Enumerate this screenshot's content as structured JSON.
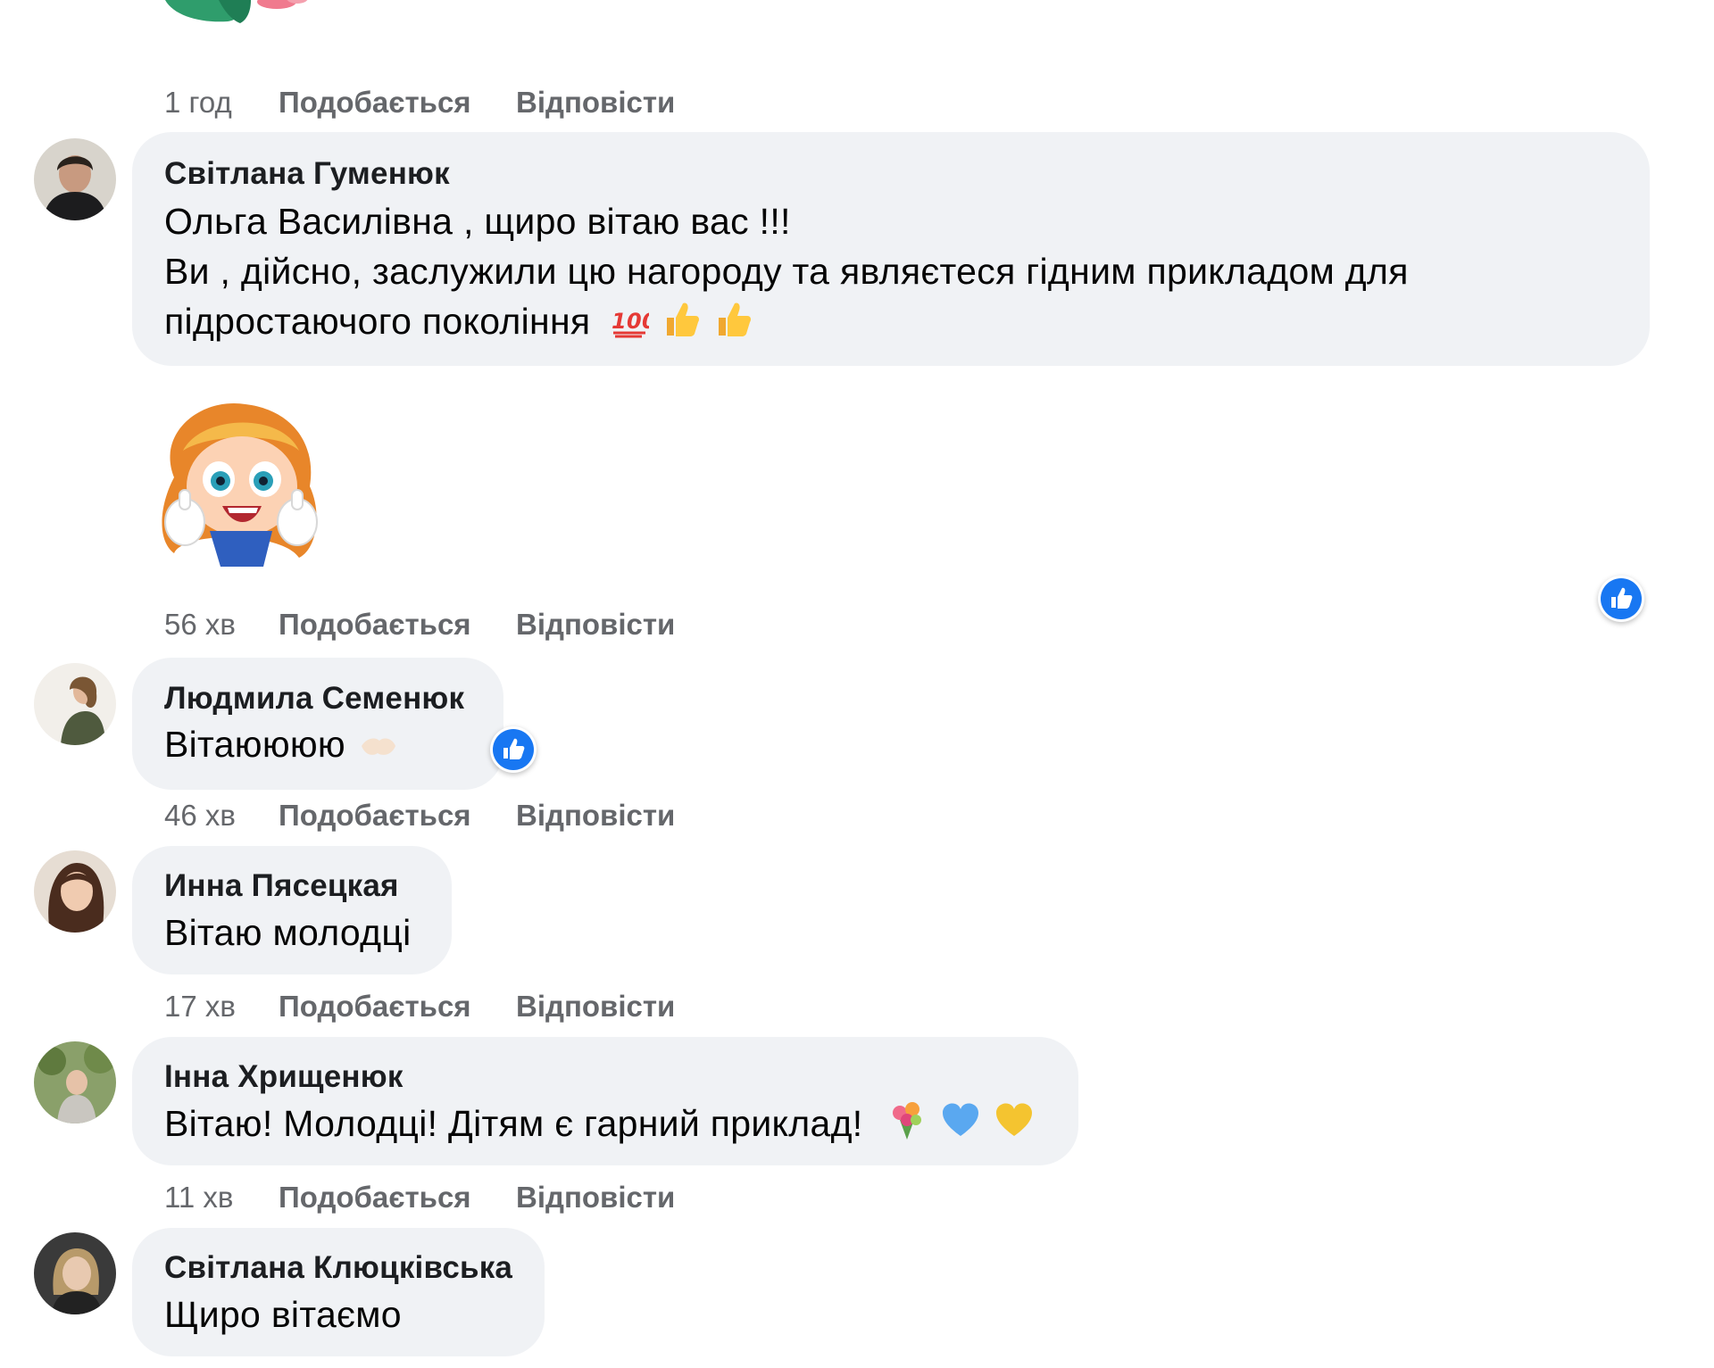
{
  "comments": [
    {
      "time": "1 год",
      "like_label": "Подобається",
      "reply_label": "Відповісти"
    },
    {
      "author": "Світлана Гуменюк",
      "text_lines": [
        "Ольга Василівна , щиро вітаю вас !!!",
        "Ви , дійсно, заслужили цю нагороду та являєтеся гідним прикладом для",
        "підростаючого покоління"
      ],
      "emoji": [
        "hundred-points-icon",
        "thumbs-up-icon",
        "thumbs-up-icon"
      ],
      "sticker": "girl-thumbs-up-sticker",
      "time": "56 хв",
      "like_label": "Подобається",
      "reply_label": "Відповісти",
      "reaction": "like"
    },
    {
      "author": "Людмила Семенюк",
      "text": "Вітаюююю",
      "emoji": [
        "handshake-icon"
      ],
      "time": "46 хв",
      "like_label": "Подобається",
      "reply_label": "Відповісти",
      "reaction": "like"
    },
    {
      "author": "Инна Пясецкая",
      "text": "Вітаю молодці",
      "time": "17 хв",
      "like_label": "Подобається",
      "reply_label": "Відповісти"
    },
    {
      "author": "Інна Хрищенюк",
      "text": "Вітаю! Молодці! Дітям є гарний приклад!",
      "emoji": [
        "bouquet-icon",
        "blue-heart-icon",
        "yellow-heart-icon"
      ],
      "time": "11 хв",
      "like_label": "Подобається",
      "reply_label": "Відповісти"
    },
    {
      "author": "Світлана Клюцківська",
      "text": "Щиро вітаємо"
    }
  ],
  "colors": {
    "bubble": "#f0f2f5",
    "meta_text": "#65676b",
    "like_blue": "#1877f2"
  }
}
